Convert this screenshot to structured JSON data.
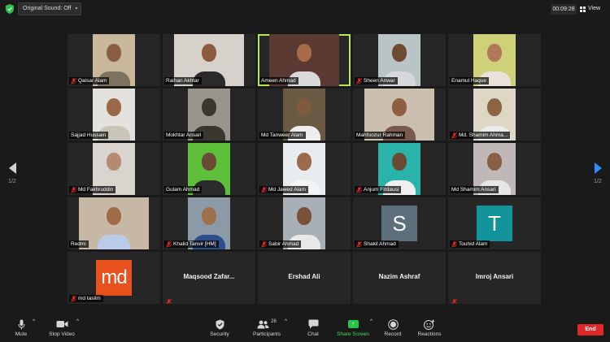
{
  "top_bar": {
    "original_sound_label": "Original Sound: Off",
    "timer": "00:09:28",
    "view_label": "View"
  },
  "pagination": {
    "left_page": "1/2",
    "right_page": "1/2"
  },
  "colors": {
    "accent_blue": "#2d8cff",
    "active_speaker": "#b6e94a",
    "end_red": "#e02828",
    "share_green": "#28c34a",
    "muted_red": "#e02828"
  },
  "participants": [
    {
      "name": "Qaisar Alam",
      "muted": true,
      "bg": "#c9b79c",
      "skin": "#8a5e42",
      "shirt": "#7d7460"
    },
    {
      "name": "Raihan Akhtar",
      "muted": false,
      "bg": "#d6d1ca",
      "skin": "#8c5b3d",
      "shirt": "#2a2a2a",
      "wide": true
    },
    {
      "name": "Ameen Ahmad",
      "muted": false,
      "active": true,
      "bg": "#5a3a32",
      "skin": "#a86b47",
      "shirt": "#d9d9d9",
      "wide": true
    },
    {
      "name": "Sheen Anwar",
      "muted": true,
      "bg": "#b9c4c6",
      "skin": "#6e4a33",
      "shirt": "#d6d8dc"
    },
    {
      "name": "Enamul Haque",
      "muted": false,
      "bg": "#cfd07a",
      "skin": "#b07a58",
      "shirt": "#e8e2d8"
    },
    {
      "name": "Sajjad Hussain",
      "muted": false,
      "bg": "#e4e2dc",
      "skin": "#9b6848",
      "shirt": "#c9c4b8"
    },
    {
      "name": "Mokhtar Ansari",
      "muted": false,
      "bg": "#9a958c",
      "skin": "#3a3630",
      "shirt": "#3a3630"
    },
    {
      "name": "Md Tanweer Alam",
      "muted": false,
      "bg": "#6a5a44",
      "skin": "#7e5a3f",
      "shirt": "#eeeeee"
    },
    {
      "name": "Mahfoozur Rahman",
      "muted": false,
      "bg": "#cabfae",
      "skin": "#8d5e40",
      "shirt": "#7a5a4e",
      "wide": true
    },
    {
      "name": "Md. Shamim Ahma...",
      "muted": true,
      "bg": "#ded7c6",
      "skin": "#8f6446",
      "shirt": "#ebebeb"
    },
    {
      "name": "Md Fakhruddin",
      "muted": true,
      "bg": "#d9d4cd",
      "skin": "#b48a70",
      "shirt": "#d9d4cd"
    },
    {
      "name": "Gulam Ahmad",
      "muted": false,
      "bg": "#5dbf3a",
      "skin": "#6a4a34",
      "shirt": "#2b2b2b"
    },
    {
      "name": "Md Jawed Alam",
      "muted": true,
      "bg": "#e8ecef",
      "skin": "#9a6a4a",
      "shirt": "#f2f4f6"
    },
    {
      "name": "Anjum Firdausi",
      "muted": true,
      "bg": "#2ab3a8",
      "skin": "#6b4a34",
      "shirt": "#efefef"
    },
    {
      "name": "Md Shamim Ansari",
      "muted": false,
      "bg": "#bfb8b6",
      "skin": "#8a5f45",
      "shirt": "#e6e6e6"
    },
    {
      "name": "Redmi",
      "muted": false,
      "bg": "#c7b8a6",
      "skin": "#a06a48",
      "shirt": "#b9cbe6",
      "wide": true
    },
    {
      "name": "Khalid Tanvir [HM]",
      "muted": true,
      "bg": "#8c9aa8",
      "skin": "#a0704c",
      "shirt": "#2c4f8c"
    },
    {
      "name": "Sabir Ahmad",
      "muted": true,
      "bg": "#a7b0b7",
      "skin": "#7a5038",
      "shirt": "#e8e8e8"
    },
    {
      "name": "Shakil Ahmad",
      "muted": true,
      "avatar": "S",
      "avatar_bg": "#5d6f7a"
    },
    {
      "name": "Touhid Alam",
      "muted": true,
      "avatar": "T",
      "avatar_bg": "#12939b"
    },
    {
      "name": "md taslim",
      "muted": true,
      "avatar": "md",
      "avatar_bg": "#e8501c"
    },
    {
      "name": "Maqsood  Zafar...",
      "muted": true,
      "center": true
    },
    {
      "name": "Ershad Ali",
      "muted": false,
      "center": true
    },
    {
      "name": "Nazim Ashraf",
      "muted": false,
      "center": true
    },
    {
      "name": "Imroj Ansari",
      "muted": true,
      "center": true
    }
  ],
  "toolbar": {
    "mute": "Mute",
    "stop_video": "Stop Video",
    "security": "Security",
    "participants": "Participants",
    "participants_count": "26",
    "chat": "Chat",
    "share_screen": "Share Screen",
    "record": "Record",
    "reactions": "Reactions",
    "end": "End"
  }
}
